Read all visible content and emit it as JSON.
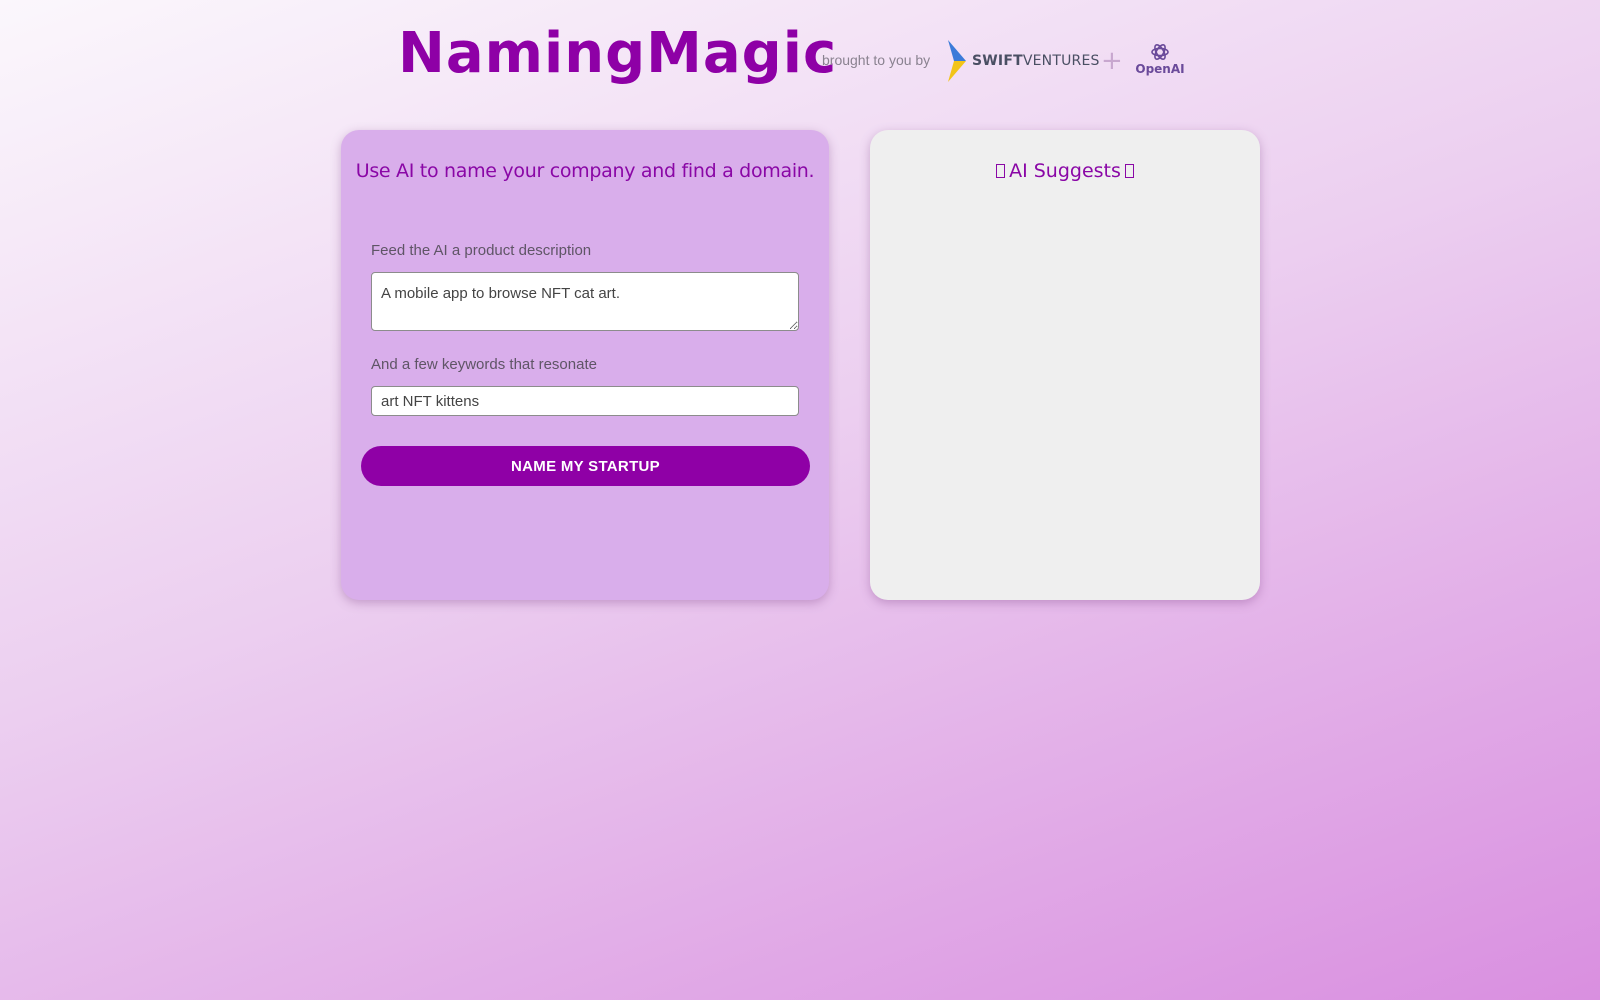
{
  "header": {
    "logo": "NamingMagic",
    "brought_by": "brought to you by",
    "swift_bold": "SWIFT",
    "swift_light": "VENTURES",
    "plus": "+",
    "openai": "OpenAI"
  },
  "form": {
    "heading": "Use AI to name your company and find a domain.",
    "description_label": "Feed the AI a product description",
    "description_value": "A mobile app to browse NFT cat art.",
    "keywords_label": "And a few keywords that resonate",
    "keywords_value": "art NFT kittens",
    "submit_label": "NAME MY STARTUP"
  },
  "results": {
    "heading": "AI Suggests"
  },
  "colors": {
    "brand": "#8e00a6",
    "form_card": "#d9aeeb",
    "results_card": "#efefef"
  },
  "icons": {
    "swift_mark": "swift-ventures-logo-icon",
    "openai": "openai-logo-icon",
    "sparkle": "sparkle-icon"
  }
}
